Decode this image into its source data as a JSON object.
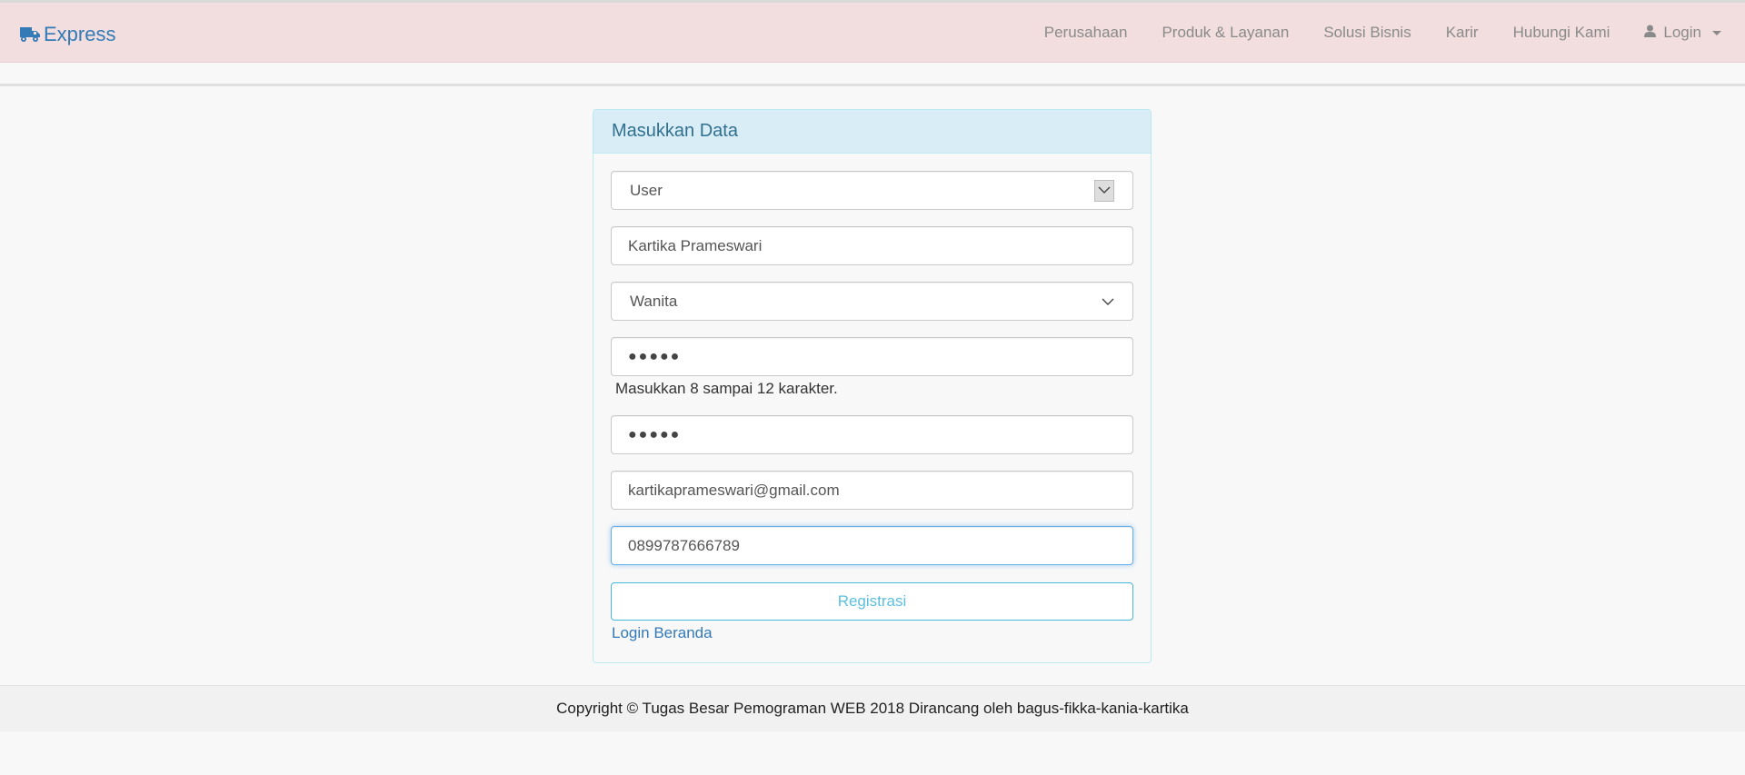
{
  "brand": {
    "label": "Express",
    "color": "#337ab7",
    "icon": "truck-icon"
  },
  "nav": {
    "items": [
      "Perusahaan",
      "Produk & Layanan",
      "Solusi Bisnis",
      "Karir",
      "Hubungi Kami"
    ],
    "login": {
      "label": "Login",
      "icon": "user-icon"
    }
  },
  "panel": {
    "title": "Masukkan Data",
    "role_select": {
      "value": "User"
    },
    "name_input": {
      "value": "Kartika Prameswari"
    },
    "gender_select": {
      "value": "Wanita"
    },
    "password_input": {
      "value": "●●●●●"
    },
    "password_help": "Masukkan 8 sampai 12 karakter.",
    "confirm_password_input": {
      "value": "●●●●●"
    },
    "email_input": {
      "value": "kartikaprameswari@gmail.com"
    },
    "phone_input": {
      "value": "0899787666789"
    },
    "register_button": "Registrasi",
    "home_login_link": "Login Beranda"
  },
  "footer": {
    "text": "Copyright © Tugas Besar Pemograman WEB 2018 Dirancang oleh bagus-fikka-kania-kartika"
  },
  "colors": {
    "navbar_bg": "#f2dede",
    "panel_heading_bg": "#d9edf7",
    "panel_heading_text": "#31708f",
    "button_info": "#5bc0de",
    "link": "#337ab7"
  }
}
